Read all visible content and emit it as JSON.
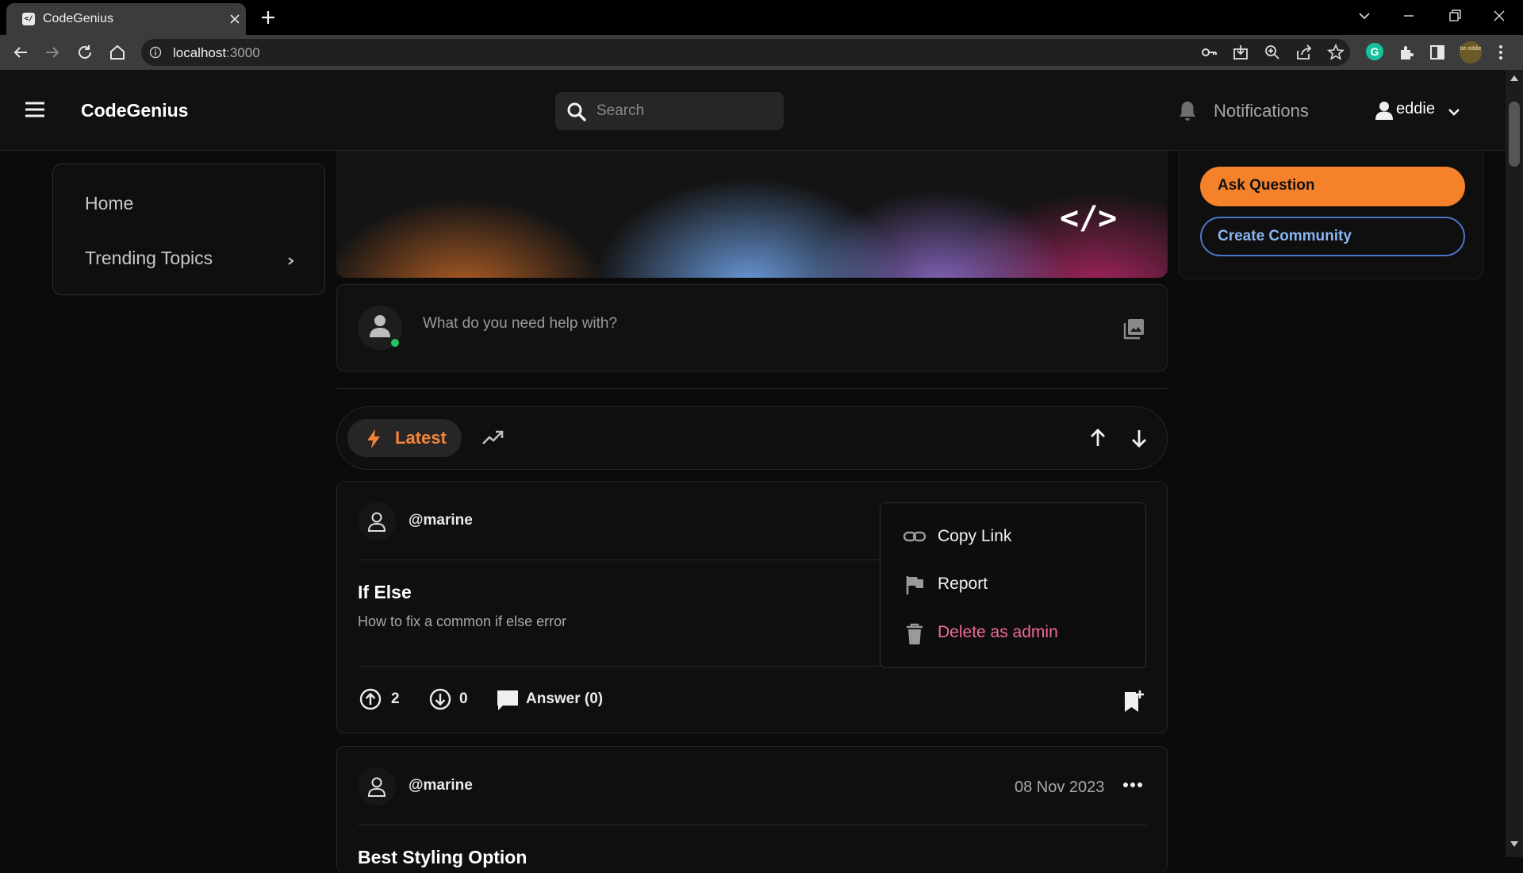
{
  "browser": {
    "tab_title": "CodeGenius",
    "tab_favicon_text": "</",
    "url_host": "localhost",
    "url_port": ":3000",
    "profile_text": "be eddie"
  },
  "header": {
    "brand": "CodeGenius",
    "search_placeholder": "Search",
    "notifications_label": "Notifications",
    "username": "eddie"
  },
  "sidebar": {
    "items": [
      {
        "label": "Home"
      },
      {
        "label": "Trending Topics"
      }
    ]
  },
  "banner": {
    "code_text": "</>"
  },
  "composer": {
    "placeholder": "What do you need help with?"
  },
  "sort_bar": {
    "active_label": "Latest"
  },
  "posts": [
    {
      "user": "@marine",
      "title": "If Else",
      "body": "How to fix a common if else error",
      "upvotes": "2",
      "downvotes": "0",
      "answers_label": "Answer (0)"
    },
    {
      "user": "@marine",
      "date": "08 Nov 2023",
      "title": "Best Styling Option"
    }
  ],
  "context_menu": {
    "items": [
      {
        "label": "Copy Link",
        "color": "#f0f0f0"
      },
      {
        "label": "Report",
        "color": "#f0f0f0"
      },
      {
        "label": "Delete as admin",
        "color": "#f06a9a"
      }
    ]
  },
  "right_panel": {
    "ask_label": "Ask Question",
    "community_label": "Create Community"
  },
  "colors": {
    "accent_orange": "#f5822a",
    "accent_blue": "#4a78c8",
    "danger_pink": "#f06a9a",
    "online_green": "#22c55e"
  }
}
